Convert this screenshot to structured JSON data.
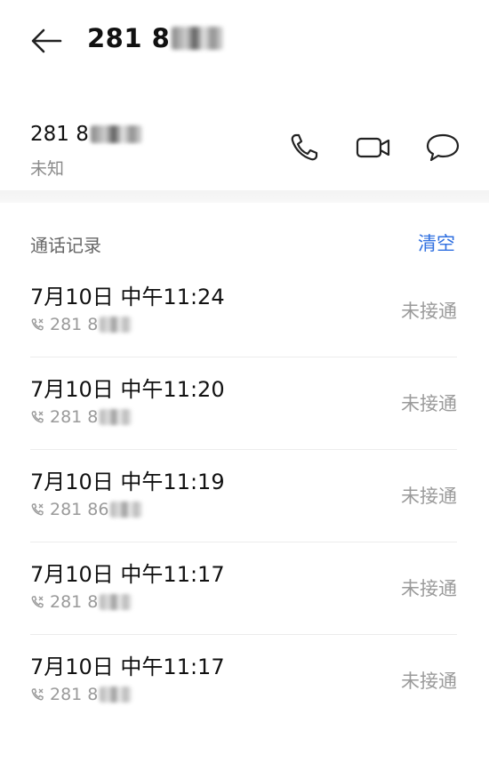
{
  "header": {
    "title_visible": "281 8"
  },
  "contact": {
    "number_visible": "281 8",
    "label": "未知"
  },
  "actions": {
    "icons": [
      "phone-icon",
      "video-call-icon",
      "message-icon"
    ]
  },
  "call_log": {
    "title": "通话记录",
    "clear_label": "清空",
    "records": [
      {
        "time": "7月10日 中午11:24",
        "number": "281 8",
        "status": "未接通"
      },
      {
        "time": "7月10日 中午11:20",
        "number": "281 8",
        "status": "未接通"
      },
      {
        "time": "7月10日 中午11:19",
        "number": "281 86",
        "status": "未接通"
      },
      {
        "time": "7月10日 中午11:17",
        "number": "281 8",
        "status": "未接通"
      },
      {
        "time": "7月10日 中午11:17",
        "number": "281 8",
        "status": "未接通"
      }
    ]
  },
  "colors": {
    "accent": "#2f6fe0",
    "secondary_text": "#9a9a9a"
  }
}
